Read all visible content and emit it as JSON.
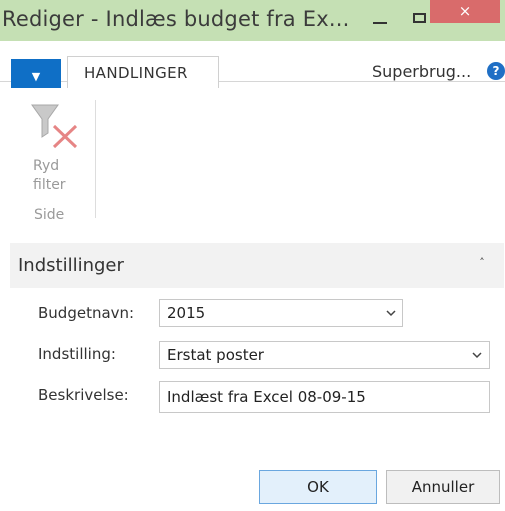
{
  "window": {
    "title": "Rediger - Indlæs budget fra Ex...",
    "close_symbol": "×"
  },
  "ribbon": {
    "menu_symbol": "▼",
    "tab_label": "HANDLINGER",
    "user_label": "Superbrug...",
    "help_symbol": "?",
    "clear_filter_label": "Ryd\nfilter",
    "clear_filter_line1": "Ryd",
    "clear_filter_line2": "filter",
    "group_label": "Side"
  },
  "section": {
    "title": "Indstillinger",
    "collapse_symbol": "˄"
  },
  "form": {
    "budget_label": "Budgetnavn:",
    "budget_value": "2015",
    "setting_label": "Indstilling:",
    "setting_value": "Erstat poster",
    "description_label": "Beskrivelse:",
    "description_value": "Indlæst fra Excel 08-09-15"
  },
  "actions": {
    "ok_label": "OK",
    "cancel_label": "Annuller"
  },
  "colors": {
    "titlebar": "#c5e0b4",
    "close_button": "#d96b6b",
    "menu_button": "#0f6fc6",
    "ok_button_border": "#6aa7df"
  },
  "icons": {
    "clear_filter": "filter-clear-icon",
    "minimize": "minimize-icon",
    "maximize": "maximize-icon",
    "close": "close-icon",
    "help": "help-icon",
    "dropdown": "chevron-down-icon",
    "collapse": "chevron-up-icon"
  }
}
